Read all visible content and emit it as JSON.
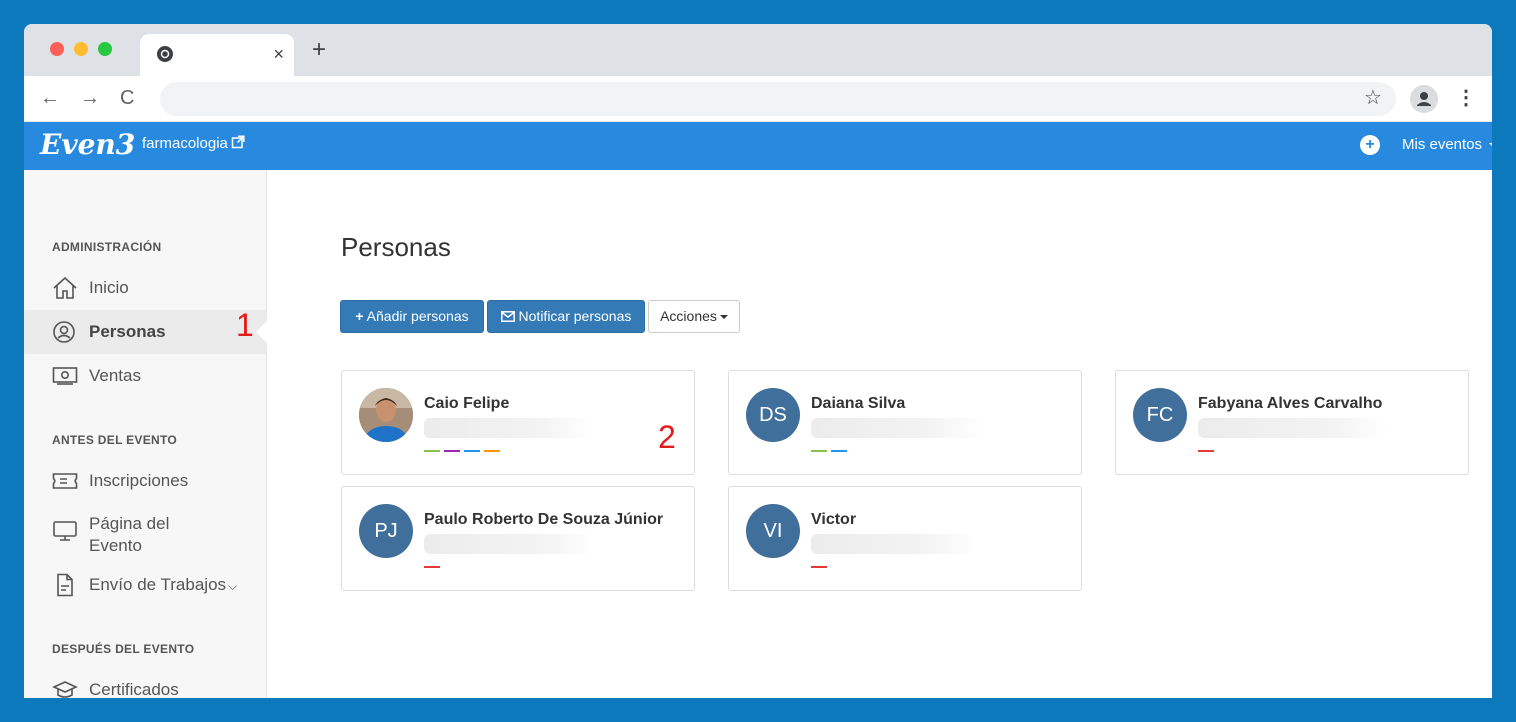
{
  "browser": {
    "tab_close": "×",
    "new_tab": "+",
    "nav_back": "←",
    "nav_forward": "→",
    "nav_reload": "C",
    "star": "☆",
    "menu": "⋮"
  },
  "app": {
    "logo": "Even3",
    "event_name": "farmacologia",
    "external_link_icon": "external-link-icon",
    "add_icon": "+",
    "my_events_label": "Mis eventos"
  },
  "sidebar": {
    "sections": [
      {
        "label": "ADMINISTRACIÓN",
        "items": [
          {
            "label": "Inicio",
            "icon": "home-icon"
          },
          {
            "label": "Personas",
            "icon": "user-circle-icon",
            "active": true
          },
          {
            "label": "Ventas",
            "icon": "money-icon"
          }
        ]
      },
      {
        "label": "ANTES DEL EVENTO",
        "items": [
          {
            "label": "Inscripciones",
            "icon": "ticket-icon"
          },
          {
            "label": "Página del Evento",
            "label_line1": "Página del",
            "label_line2": "Evento",
            "icon": "monitor-icon"
          },
          {
            "label": "Envío de Trabajos",
            "icon": "document-icon",
            "chevron": "⌵"
          }
        ]
      },
      {
        "label": "DESPUÉS DEL EVENTO",
        "items": [
          {
            "label": "Certificados",
            "icon": "graduation-cap-icon"
          }
        ]
      }
    ]
  },
  "main": {
    "title": "Personas",
    "buttons": {
      "add": "Añadir personas",
      "notify": "Notificar personas",
      "actions": "Acciones"
    },
    "people": [
      {
        "name": "Caio Felipe",
        "initials": "",
        "photo": true,
        "tags": [
          "#8bc34a",
          "#9c27b0",
          "#2196f3",
          "#ff9800"
        ]
      },
      {
        "name": "Daiana Silva",
        "initials": "DS",
        "photo": false,
        "tags": [
          "#8bc34a",
          "#2196f3"
        ]
      },
      {
        "name": "Fabyana Alves Carvalho",
        "initials": "FC",
        "photo": false,
        "tags": [
          "#e53935"
        ]
      },
      {
        "name": "Paulo Roberto De Souza Júnior",
        "initials": "PJ",
        "photo": false,
        "tags": [
          "#e53935"
        ]
      },
      {
        "name": "Victor",
        "initials": "VI",
        "photo": false,
        "tags": [
          "#e53935"
        ]
      }
    ]
  },
  "annotations": {
    "marker_1": "1",
    "marker_2": "2"
  },
  "colors": {
    "frame_blue": "#0d79bd",
    "app_bar": "#288adf",
    "primary_button": "#337ab7",
    "avatar_bg": "#3f6f9a",
    "annotation_red": "#e21b1b"
  }
}
